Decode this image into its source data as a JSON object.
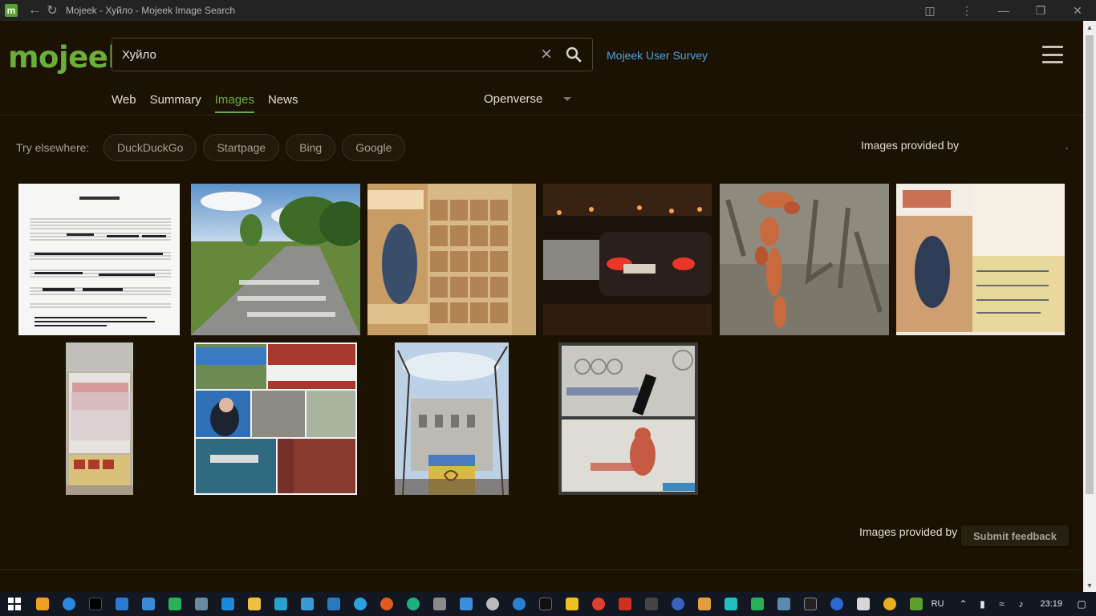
{
  "window": {
    "title": "Mojeek - Хуйло - Mojeek Image Search"
  },
  "header": {
    "logo": "mojeek",
    "search_value": "Хуйло",
    "survey_link": "Mojeek User Survey"
  },
  "nav": {
    "tabs": [
      {
        "label": "Web",
        "active": false
      },
      {
        "label": "Summary",
        "active": false
      },
      {
        "label": "Images",
        "active": true
      },
      {
        "label": "News",
        "active": false
      }
    ],
    "provider": "Openverse"
  },
  "elsewhere": {
    "label": "Try elsewhere:",
    "engines": [
      "DuckDuckGo",
      "Startpage",
      "Bing",
      "Google"
    ],
    "provided_by": "Images provided by",
    "provided_dot": "."
  },
  "results": [
    {
      "name": "sheet-music-image",
      "depicts": "sheet music"
    },
    {
      "name": "road-graffiti-image",
      "depicts": "road with text"
    },
    {
      "name": "stamp-sheet-image",
      "depicts": "stamp sheet"
    },
    {
      "name": "night-traffic-image",
      "depicts": "cars at night"
    },
    {
      "name": "ivy-wall-image",
      "depicts": "wall with ivy"
    },
    {
      "name": "postcard-image",
      "depicts": "postcard"
    },
    {
      "name": "poster-image",
      "depicts": "posters"
    },
    {
      "name": "collage-image",
      "depicts": "collage"
    },
    {
      "name": "building-image",
      "depicts": "building with sign"
    },
    {
      "name": "concrete-wall-image",
      "depicts": "concrete wall graffiti"
    }
  ],
  "footer": {
    "provided_by": "Images provided by",
    "feedback": "Submit feedback"
  },
  "taskbar": {
    "language": "RU",
    "time": "23:19"
  },
  "colors": {
    "background": "#1b1204",
    "accent": "#6cae3a",
    "link": "#4ea3e0"
  }
}
